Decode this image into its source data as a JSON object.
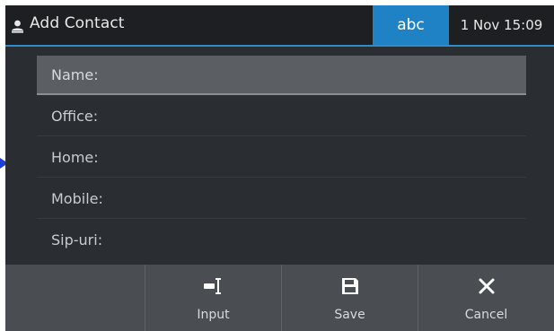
{
  "header": {
    "title": "Add Contact",
    "input_mode": "abc",
    "datetime": "1 Nov 15:09"
  },
  "fields": [
    {
      "label": "Name:",
      "selected": true
    },
    {
      "label": "Office:"
    },
    {
      "label": "Home:"
    },
    {
      "label": "Mobile:"
    },
    {
      "label": "Sip-uri:"
    }
  ],
  "softkeys": [
    {
      "label": "",
      "icon": "empty"
    },
    {
      "label": "Input",
      "icon": "input-cursor-icon"
    },
    {
      "label": "Save",
      "icon": "save-icon"
    },
    {
      "label": "Cancel",
      "icon": "close-icon"
    }
  ],
  "colors": {
    "accent": "#1f82c4",
    "background": "#2a2d31",
    "softkey_bar": "#4a4d51",
    "pointer_arrow": "#1e3fd6"
  }
}
